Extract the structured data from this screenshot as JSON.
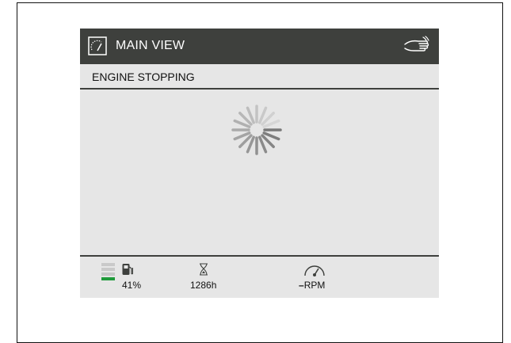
{
  "header": {
    "title": "MAIN VIEW",
    "left_icon": "dial-view-icon",
    "right_icon": "hand-touch-icon"
  },
  "status_message": "ENGINE STOPPING",
  "spinner": {
    "icon": "loading-spinner"
  },
  "statusbar": {
    "fuel": {
      "value": "41%",
      "level_fraction": 0.41,
      "icon": "fuel-pump-icon"
    },
    "engine_hours": {
      "value": "1286h",
      "icon": "hourglass-icon"
    },
    "rpm": {
      "dash": "–",
      "unit": "RPM",
      "icon": "tachometer-icon"
    }
  },
  "colors": {
    "titlebar": "#3e403d",
    "background": "#e6e6e6",
    "fuel_on": "#1f9a3b",
    "fuel_off": "#c9c9c9"
  }
}
